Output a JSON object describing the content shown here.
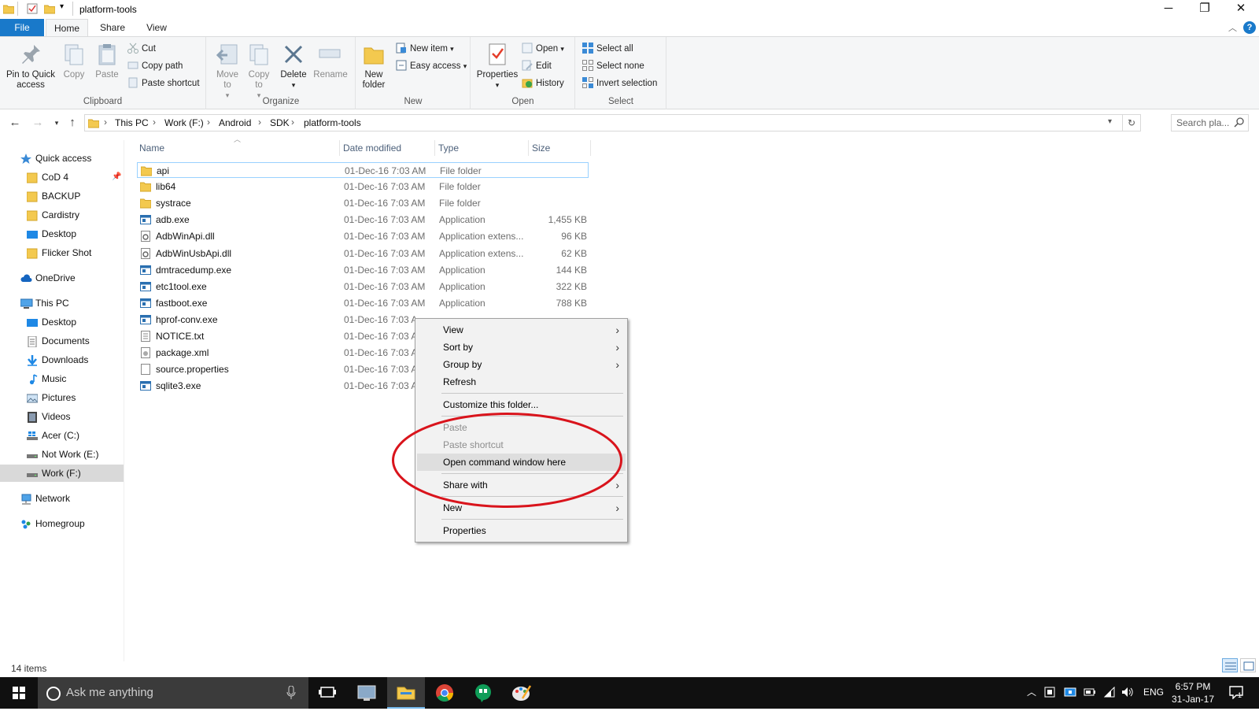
{
  "window": {
    "title": "platform-tools",
    "minimize": "─",
    "maximize": "❐",
    "close": "✕"
  },
  "ribbon_tabs": [
    "File",
    "Home",
    "Share",
    "View"
  ],
  "ribbon": {
    "clipboard": {
      "label": "Clipboard",
      "pin": "Pin to Quick access",
      "copy": "Copy",
      "paste": "Paste",
      "cut": "Cut",
      "copy_path": "Copy path",
      "paste_shortcut": "Paste shortcut"
    },
    "organize": {
      "label": "Organize",
      "move_to": "Move to",
      "copy_to": "Copy to",
      "delete": "Delete",
      "rename": "Rename"
    },
    "new": {
      "label": "New",
      "new_folder": "New folder",
      "new_item": "New item",
      "easy_access": "Easy access"
    },
    "open": {
      "label": "Open",
      "properties": "Properties",
      "open": "Open",
      "edit": "Edit",
      "history": "History"
    },
    "select": {
      "label": "Select",
      "select_all": "Select all",
      "select_none": "Select none",
      "invert": "Invert selection"
    }
  },
  "breadcrumb": [
    "This PC",
    "Work (F:)",
    "Android",
    "SDK",
    "platform-tools"
  ],
  "search_placeholder": "Search pla...",
  "nav_pane": {
    "quick_access": "Quick access",
    "quick_items": [
      "CoD 4",
      "BACKUP",
      "Cardistry",
      "Desktop",
      "Flicker Shot"
    ],
    "onedrive": "OneDrive",
    "this_pc": "This PC",
    "pc_items": [
      "Desktop",
      "Documents",
      "Downloads",
      "Music",
      "Pictures",
      "Videos",
      "Acer (C:)",
      "Not Work (E:)",
      "Work (F:)"
    ],
    "network": "Network",
    "homegroup": "Homegroup"
  },
  "columns": {
    "name": "Name",
    "date": "Date modified",
    "type": "Type",
    "size": "Size"
  },
  "files": [
    {
      "name": "api",
      "date": "01-Dec-16 7:03 AM",
      "type": "File folder",
      "size": "",
      "kind": "folder"
    },
    {
      "name": "lib64",
      "date": "01-Dec-16 7:03 AM",
      "type": "File folder",
      "size": "",
      "kind": "folder"
    },
    {
      "name": "systrace",
      "date": "01-Dec-16 7:03 AM",
      "type": "File folder",
      "size": "",
      "kind": "folder"
    },
    {
      "name": "adb.exe",
      "date": "01-Dec-16 7:03 AM",
      "type": "Application",
      "size": "1,455 KB",
      "kind": "exe"
    },
    {
      "name": "AdbWinApi.dll",
      "date": "01-Dec-16 7:03 AM",
      "type": "Application extens...",
      "size": "96 KB",
      "kind": "dll"
    },
    {
      "name": "AdbWinUsbApi.dll",
      "date": "01-Dec-16 7:03 AM",
      "type": "Application extens...",
      "size": "62 KB",
      "kind": "dll"
    },
    {
      "name": "dmtracedump.exe",
      "date": "01-Dec-16 7:03 AM",
      "type": "Application",
      "size": "144 KB",
      "kind": "exe"
    },
    {
      "name": "etc1tool.exe",
      "date": "01-Dec-16 7:03 AM",
      "type": "Application",
      "size": "322 KB",
      "kind": "exe"
    },
    {
      "name": "fastboot.exe",
      "date": "01-Dec-16 7:03 AM",
      "type": "Application",
      "size": "788 KB",
      "kind": "exe"
    },
    {
      "name": "hprof-conv.exe",
      "date": "01-Dec-16 7:03 A",
      "type": "",
      "size": "",
      "kind": "exe"
    },
    {
      "name": "NOTICE.txt",
      "date": "01-Dec-16 7:03 A",
      "type": "",
      "size": "",
      "kind": "txt"
    },
    {
      "name": "package.xml",
      "date": "01-Dec-16 7:03 A",
      "type": "",
      "size": "",
      "kind": "xml"
    },
    {
      "name": "source.properties",
      "date": "01-Dec-16 7:03 A",
      "type": "",
      "size": "",
      "kind": "file"
    },
    {
      "name": "sqlite3.exe",
      "date": "01-Dec-16 7:03 A",
      "type": "",
      "size": "",
      "kind": "exe"
    }
  ],
  "context_menu": {
    "view": "View",
    "sort_by": "Sort by",
    "group_by": "Group by",
    "refresh": "Refresh",
    "customize": "Customize this folder...",
    "paste": "Paste",
    "paste_shortcut": "Paste shortcut",
    "open_cmd": "Open command window here",
    "share_with": "Share with",
    "new": "New",
    "properties": "Properties"
  },
  "status": {
    "item_count": "14 items"
  },
  "taskbar": {
    "search_placeholder": "Ask me anything",
    "language": "ENG",
    "time": "6:57 PM",
    "date": "31-Jan-17"
  },
  "colors": {
    "file_tab": "#1979ca",
    "folder": "#f3c94f",
    "annotation_oval": "#d9141c",
    "taskbar": "#101010"
  }
}
